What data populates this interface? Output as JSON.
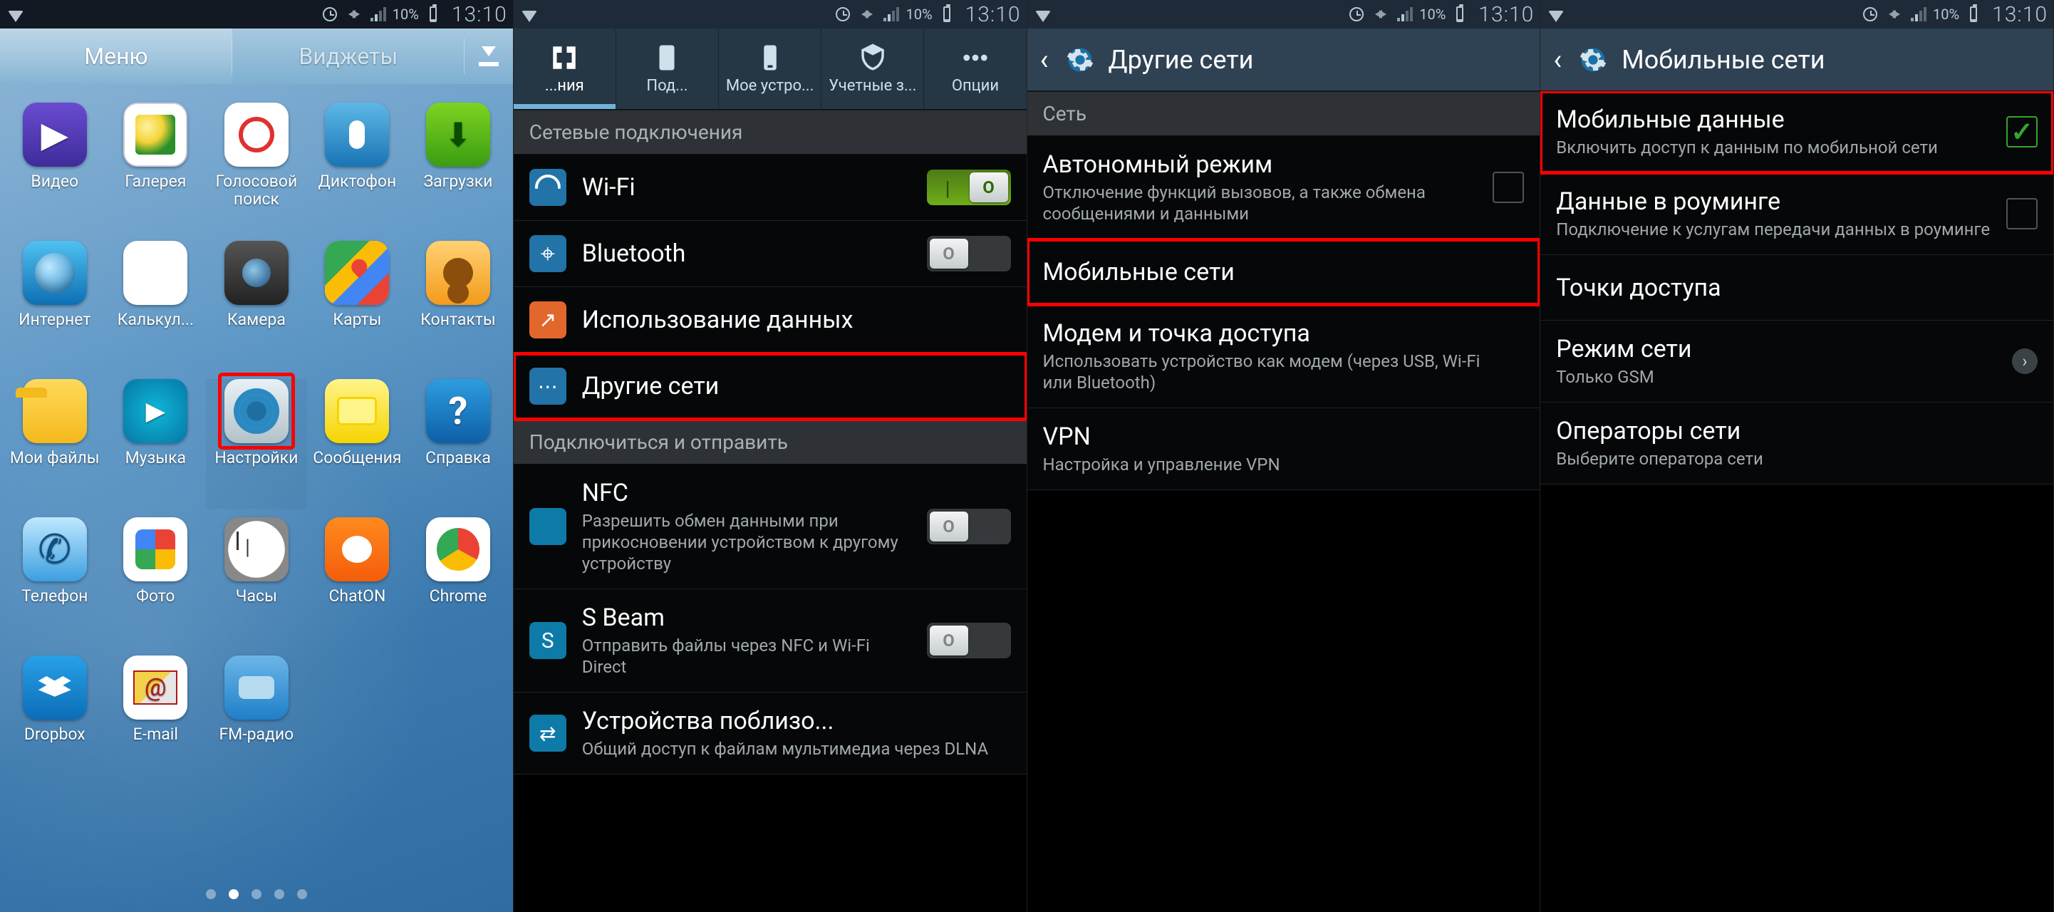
{
  "statusbar": {
    "battery_pct": "10%",
    "time": "13:10"
  },
  "screen1": {
    "tabs": {
      "menu": "Меню",
      "widgets": "Виджеты"
    },
    "apps": [
      {
        "name": "video",
        "label": "Видео"
      },
      {
        "name": "gallery",
        "label": "Галерея"
      },
      {
        "name": "voice-search",
        "label": "Голосовой поиск"
      },
      {
        "name": "recorder",
        "label": "Диктофон"
      },
      {
        "name": "downloads",
        "label": "Загрузки"
      },
      {
        "name": "internet",
        "label": "Интернет"
      },
      {
        "name": "calculator",
        "label": "Калькул..."
      },
      {
        "name": "camera",
        "label": "Камера"
      },
      {
        "name": "maps",
        "label": "Карты"
      },
      {
        "name": "contacts",
        "label": "Контакты"
      },
      {
        "name": "my-files",
        "label": "Мои файлы"
      },
      {
        "name": "music",
        "label": "Музыка"
      },
      {
        "name": "settings",
        "label": "Настройки",
        "highlight": true
      },
      {
        "name": "messages",
        "label": "Сообщения"
      },
      {
        "name": "help",
        "label": "Справка"
      },
      {
        "name": "phone",
        "label": "Телефон"
      },
      {
        "name": "photos",
        "label": "Фото"
      },
      {
        "name": "clock",
        "label": "Часы"
      },
      {
        "name": "chaton",
        "label": "ChatON"
      },
      {
        "name": "chrome",
        "label": "Chrome"
      },
      {
        "name": "dropbox",
        "label": "Dropbox"
      },
      {
        "name": "email",
        "label": "E-mail"
      },
      {
        "name": "fm-radio",
        "label": "FM-радио"
      }
    ]
  },
  "screen2": {
    "tabs": [
      {
        "name": "connections",
        "label": "...ния"
      },
      {
        "name": "device",
        "label": "Под..."
      },
      {
        "name": "my-device",
        "label": "Мое устро..."
      },
      {
        "name": "accounts",
        "label": "Учетные з..."
      },
      {
        "name": "options",
        "label": "Опции"
      }
    ],
    "section1": "Сетевые подключения",
    "rows1": [
      {
        "name": "wifi",
        "title": "Wi-Fi",
        "toggle": "on"
      },
      {
        "name": "bluetooth",
        "title": "Bluetooth",
        "toggle": "off"
      },
      {
        "name": "data-usage",
        "title": "Использование данных"
      },
      {
        "name": "more-networks",
        "title": "Другие сети",
        "highlight": true
      }
    ],
    "section2": "Подключиться и отправить",
    "rows2": [
      {
        "name": "nfc",
        "title": "NFC",
        "sub": "Разрешить обмен данными при прикосновении устройством к другому устройству",
        "toggle": "off"
      },
      {
        "name": "s-beam",
        "title": "S Beam",
        "sub": "Отправить файлы через NFC и Wi-Fi Direct",
        "toggle": "off"
      },
      {
        "name": "nearby",
        "title": "Устройства поблизо...",
        "sub": "Общий доступ к файлам мультимедиа через DLNA"
      }
    ]
  },
  "screen3": {
    "title": "Другие сети",
    "section": "Сеть",
    "rows": [
      {
        "name": "airplane-mode",
        "title": "Автономный режим",
        "sub": "Отключение функций вызовов, а также обмена сообщениями и данными",
        "checkbox": "off"
      },
      {
        "name": "mobile-networks",
        "title": "Мобильные сети",
        "highlight": true
      },
      {
        "name": "tethering",
        "title": "Модем и точка доступа",
        "sub": "Использовать устройство как модем (через USB, Wi-Fi или Bluetooth)"
      },
      {
        "name": "vpn",
        "title": "VPN",
        "sub": "Настройка и управление VPN"
      }
    ]
  },
  "screen4": {
    "title": "Мобильные сети",
    "rows": [
      {
        "name": "mobile-data",
        "title": "Мобильные данные",
        "sub": "Включить доступ к данным по мобильной сети",
        "checkbox": "on",
        "highlight": true
      },
      {
        "name": "data-roaming",
        "title": "Данные в роуминге",
        "sub": "Подключение к услугам передачи данных в роуминге",
        "checkbox": "off"
      },
      {
        "name": "apn",
        "title": "Точки доступа"
      },
      {
        "name": "network-mode",
        "title": "Режим сети",
        "sub": "Только GSM",
        "chevron": true
      },
      {
        "name": "operators",
        "title": "Операторы сети",
        "sub": "Выберите оператора сети"
      }
    ]
  }
}
